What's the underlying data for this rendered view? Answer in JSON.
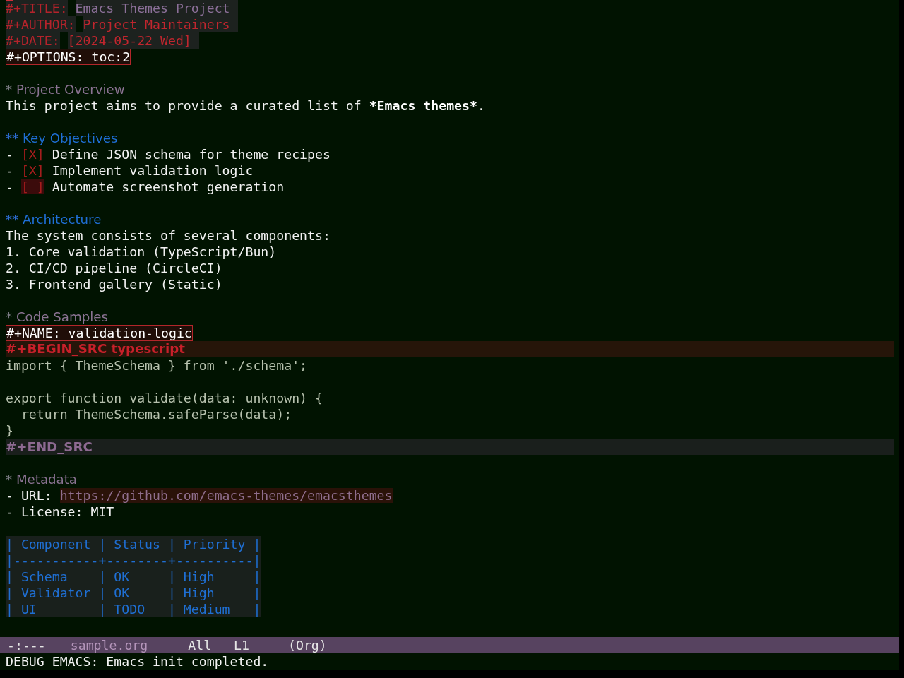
{
  "editor": {
    "keywords": [
      {
        "kind": "title",
        "key": "#+TITLE:",
        "value": "Emacs Themes Project",
        "cursor": true
      },
      {
        "kind": "author",
        "key": "#+AUTHOR:",
        "value": "Project Maintainers",
        "cursor": false
      },
      {
        "kind": "date",
        "key": "#+DATE:",
        "value": "[2024-05-22 Wed]",
        "cursor": false
      },
      {
        "kind": "option",
        "key": "#+OPTIONS:",
        "value": "toc:2",
        "cursor": false
      }
    ],
    "blocks": [
      {
        "kind": "heading1",
        "marker": "*",
        "title": "Project Overview"
      },
      {
        "kind": "paragraph",
        "parts": [
          {
            "text": "This project aims to provide a curated list of ",
            "bold": false
          },
          {
            "text": "*Emacs themes*",
            "bold": true
          },
          {
            "text": ".",
            "bold": false
          }
        ]
      },
      {
        "kind": "heading2",
        "marker": "**",
        "title": "Key Objectives"
      },
      {
        "kind": "checklist",
        "items": [
          {
            "bullet": "-",
            "box": "[X]",
            "checked": true,
            "text": "Define JSON schema for theme recipes"
          },
          {
            "bullet": "-",
            "box": "[X]",
            "checked": true,
            "text": "Implement validation logic"
          },
          {
            "bullet": "-",
            "box": "[ ]",
            "checked": false,
            "text": "Automate screenshot generation"
          }
        ]
      },
      {
        "kind": "heading2",
        "marker": "**",
        "title": "Architecture"
      },
      {
        "kind": "paragraph",
        "parts": [
          {
            "text": "The system consists of several components:",
            "bold": false
          }
        ]
      },
      {
        "kind": "numbered",
        "items": [
          {
            "number": "1.",
            "text": "Core validation (TypeScript/Bun)"
          },
          {
            "number": "2.",
            "text": "CI/CD pipeline (CircleCI)"
          },
          {
            "number": "3.",
            "text": "Frontend gallery (Static)"
          }
        ]
      },
      {
        "kind": "heading1",
        "marker": "*",
        "title": "Code Samples"
      },
      {
        "kind": "affiliated",
        "key": "#+NAME:",
        "value": "validation-logic"
      },
      {
        "kind": "source",
        "begin": "#+BEGIN_SRC typescript",
        "code": "import { ThemeSchema } from './schema';\n\nexport function validate(data: unknown) {\n  return ThemeSchema.safeParse(data);\n}",
        "end": "#+END_SRC"
      },
      {
        "kind": "heading1",
        "marker": "*",
        "title": "Metadata"
      },
      {
        "kind": "metadata",
        "items": [
          {
            "kind": "link",
            "bullet": "-",
            "label": "URL:",
            "link": "https://github.com/emacs-themes/emacsthemes"
          },
          {
            "kind": "text",
            "bullet": "-",
            "text": "License: MIT"
          }
        ]
      },
      {
        "kind": "table",
        "lines": [
          "| Component | Status | Priority |",
          "|-----------+--------+----------|",
          "| Schema    | OK     | High     |",
          "| Validator | OK     | High     |",
          "| UI        | TODO   | Medium   |"
        ]
      }
    ]
  },
  "mode_line": {
    "status": "-:---",
    "buffer": "sample.org",
    "position": "All",
    "line": "L1",
    "mode": "(Org)"
  },
  "echo_area": "DEBUG EMACS: Emacs init completed."
}
